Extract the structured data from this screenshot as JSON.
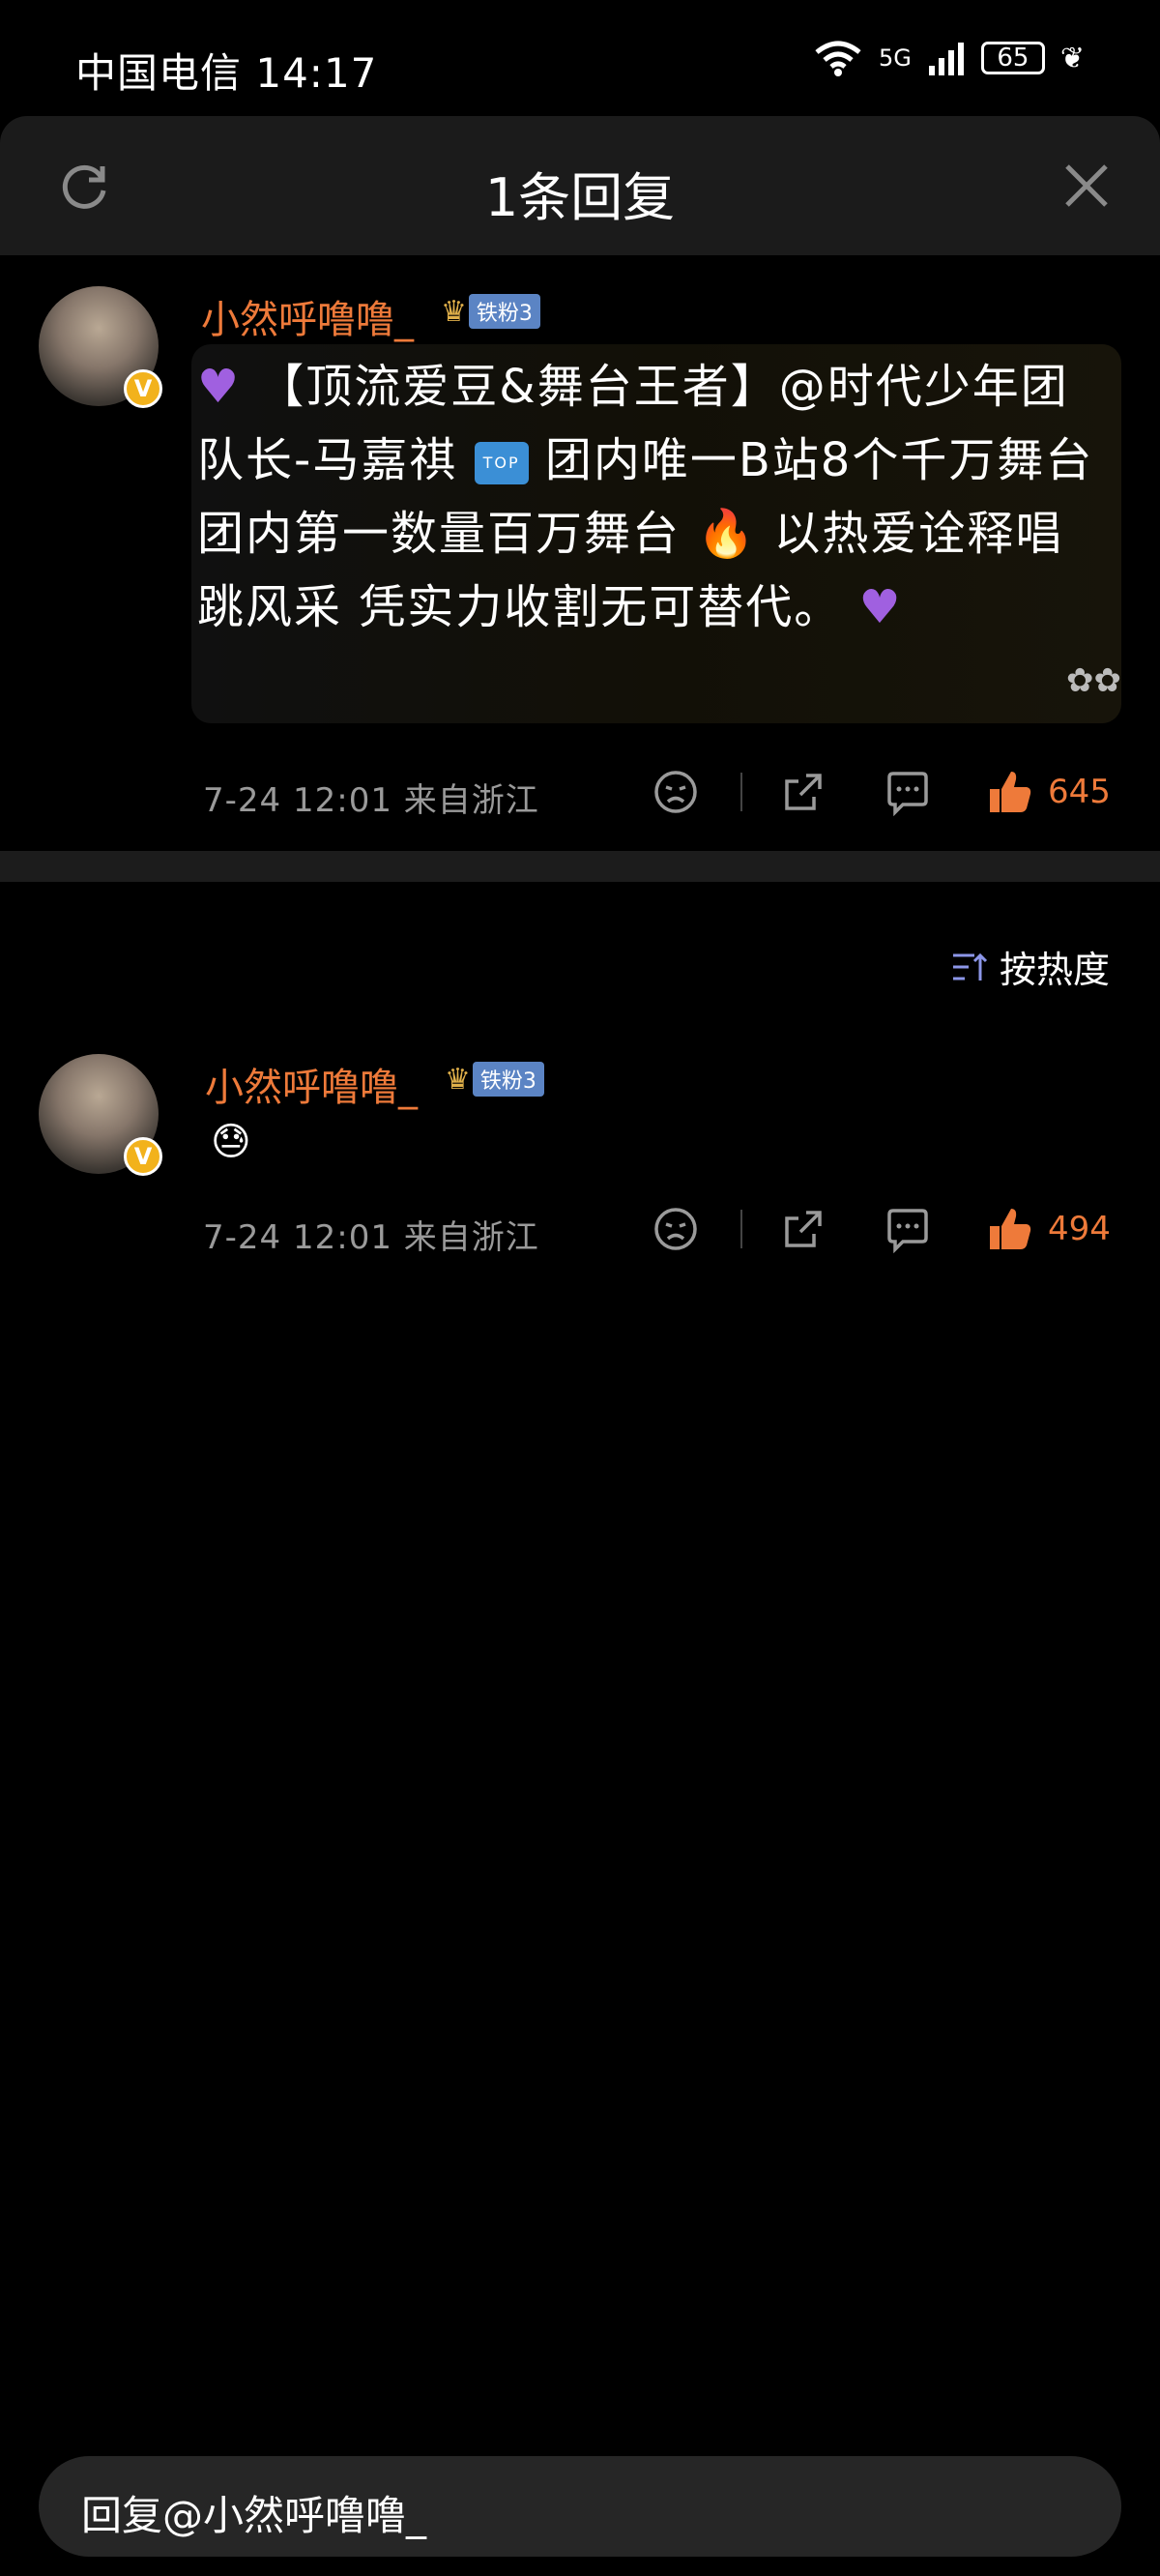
{
  "status_bar": {
    "carrier_time": "中国电信 14:17",
    "network": "5G",
    "battery": "65"
  },
  "header": {
    "title": "1条回复"
  },
  "root_comment": {
    "username": "小然呼噜噜_",
    "fan_badge": "铁粉3",
    "text_parts": {
      "p1": "【顶流爱豆&舞台王者】@时代少年团队长-马嘉祺",
      "p2": "团内唯一B站8个千万舞台 团内第一数量百万舞台",
      "p3": "以热爱诠释唱跳风采 凭实力收割无可替代。",
      "top_label": "TOP"
    },
    "meta": "7-24 12:01 来自浙江",
    "likes": "645"
  },
  "sort": {
    "label": "按热度"
  },
  "reply": {
    "username": "小然呼噜噜_",
    "fan_badge": "铁粉3",
    "meta": "7-24 12:01 来自浙江",
    "likes": "494"
  },
  "input": {
    "placeholder": "回复@小然呼噜噜_"
  },
  "colors": {
    "accent_orange": "#ee7a3a",
    "background": "#000000",
    "header_bg": "#1b1b1b"
  }
}
